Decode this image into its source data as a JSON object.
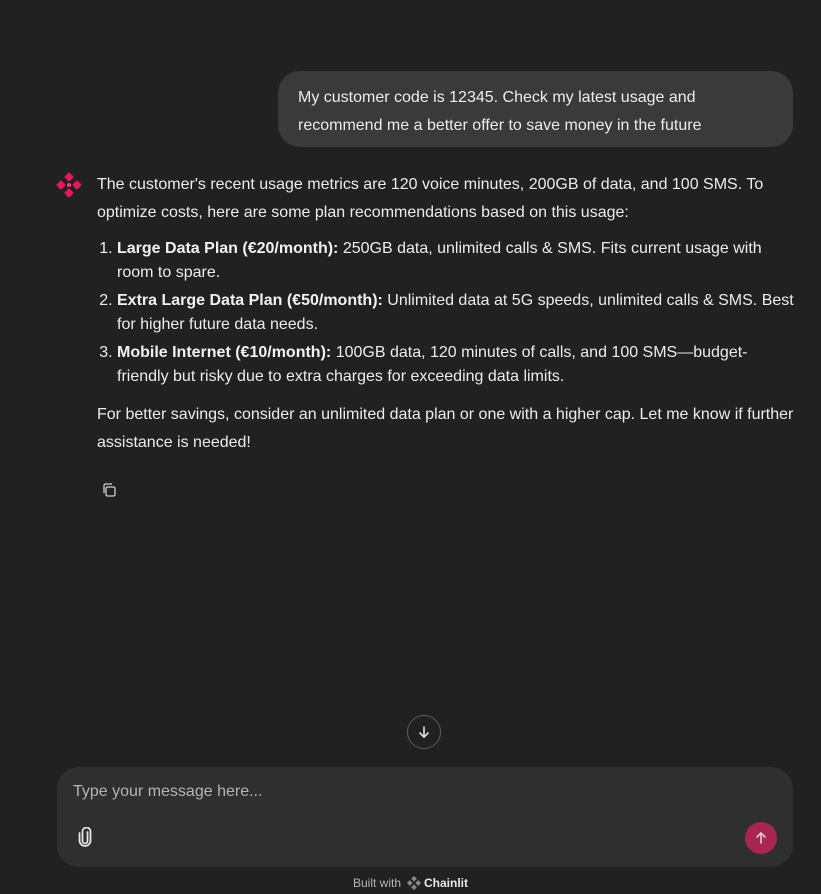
{
  "conversation": {
    "user_message": "My customer code is 12345. Check my latest usage and recommend me a better offer to save money in the future",
    "assistant": {
      "intro": "The customer's recent usage metrics are 120 voice minutes, 200GB of data, and 100 SMS. To optimize costs, here are some plan recommendations based on this usage:",
      "plans": [
        {
          "title": "Large Data Plan (€20/month):",
          "description": "250GB data, unlimited calls & SMS. Fits current usage with room to spare."
        },
        {
          "title": "Extra Large Data Plan (€50/month):",
          "description": "Unlimited data at 5G speeds, unlimited calls & SMS. Best for higher future data needs."
        },
        {
          "title": "Mobile Internet (€10/month):",
          "description": "100GB data, 120 minutes of calls, and 100 SMS—budget-friendly but risky due to extra charges for exceeding data limits."
        }
      ],
      "closing": "For better savings, consider an unlimited data plan or one with a higher cap. Let me know if further assistance is needed!"
    }
  },
  "icons": {
    "avatar": "chainlit-logo-icon",
    "copy": "copy-icon",
    "scroll_down": "arrow-down-icon",
    "attach": "paperclip-icon",
    "send": "arrow-up-icon"
  },
  "composer": {
    "placeholder": "Type your message here..."
  },
  "footer": {
    "built_with": "Built with",
    "brand": "Chainlit"
  },
  "colors": {
    "background": "#212121",
    "user_bubble": "#3a3a3a",
    "composer": "#2f2f2f",
    "accent": "#e8185f",
    "send_button": "#a8264f"
  }
}
